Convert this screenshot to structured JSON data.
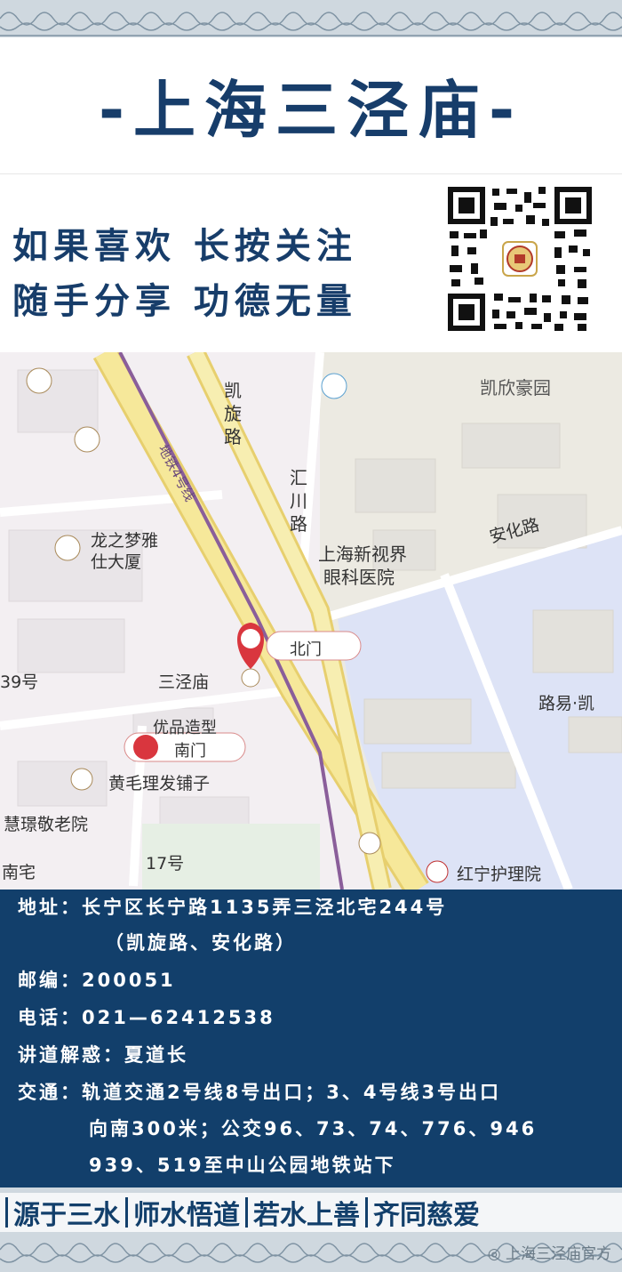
{
  "header": {
    "title": "-上海三泾庙-"
  },
  "slogans": {
    "line1": "如果喜欢 长按关注",
    "line2": "随手分享 功德无量"
  },
  "qr": {
    "name": "qr-code"
  },
  "map": {
    "labels": {
      "kaixuan_road": "凯旋路",
      "kaixin_garden": "凯欣豪园",
      "metro_line4": "地铁4号线",
      "huichuan_road": "汇川路",
      "longzhimeng": "龙之梦雅仕大厦",
      "longzhimeng_line1": "龙之梦雅",
      "longzhimeng_line2": "仕大厦",
      "anhua_road": "安化路",
      "hospital_line1": "上海新视界",
      "hospital_line2": "眼科医院",
      "north_gate": "北门",
      "sanjingmiao": "三泾庙",
      "no39": "39号",
      "luyi_kai": "路易·凯",
      "south_gate": "南门",
      "youpin": "优品造型",
      "huangmao": "黄毛理发铺子",
      "huijing": "慧璟敬老院",
      "no17": "17号",
      "nanzhai": "南宅",
      "hongning": "红宁护理院"
    }
  },
  "info": {
    "address_label": "地址：",
    "address": "长宁区长宁路1135弄三泾北宅244号",
    "address_note": "（凯旋路、安化路）",
    "postcode_label": "邮编：",
    "postcode": "200051",
    "phone_label": "电话：",
    "phone": "021—62412538",
    "teacher_label": "讲道解惑：",
    "teacher": "夏道长",
    "transit_label": "交通：",
    "transit_line1": "轨道交通2号线8号出口；3、4号线3号出口",
    "transit_line2": "向南300米；公交96、73、74、776、946",
    "transit_line3": "939、519至中山公园地铁站下"
  },
  "footer": {
    "motto1": "源于三水",
    "motto2": "师水悟道",
    "motto3": "若水上善",
    "motto4": "齐同慈爱",
    "watermark": "上海三泾庙官方"
  },
  "colors": {
    "navy": "#123f6b",
    "title_blue": "#173d6a",
    "road_yellow": "#f6e89a",
    "water_blue": "#dde3f6"
  }
}
